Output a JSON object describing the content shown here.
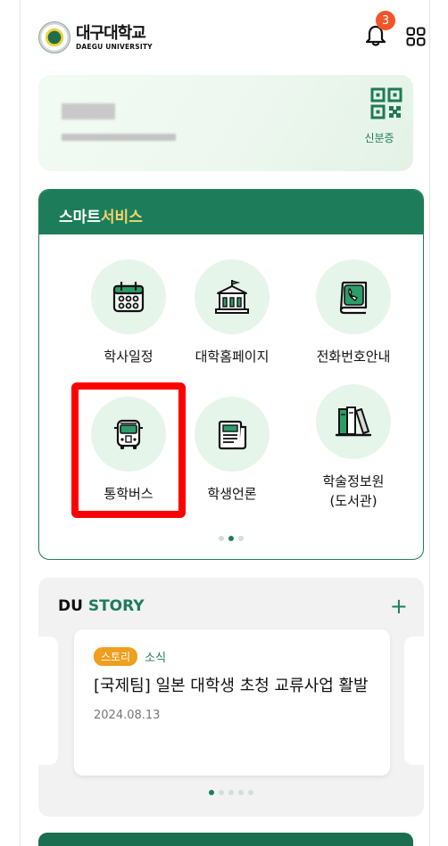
{
  "header": {
    "logo_kr": "대구대학교",
    "logo_en": "DAEGU UNIVERSITY",
    "notification_count": "3",
    "icons": [
      "bell-icon",
      "apps-grid-icon"
    ]
  },
  "id_card": {
    "qr_label": "신분증"
  },
  "smart_service": {
    "title_a": "스마트",
    "title_b": "서비스",
    "items": [
      {
        "label": "학사일정",
        "icon": "calendar-icon"
      },
      {
        "label": "대학홈페이지",
        "icon": "university-building-icon"
      },
      {
        "label": "전화번호안내",
        "icon": "phone-directory-icon"
      },
      {
        "label": "통학버스",
        "icon": "bus-icon"
      },
      {
        "label": "학생언론",
        "icon": "newspaper-icon"
      },
      {
        "label_line1": "학술정보원",
        "label_line2": "(도서관)",
        "icon": "library-books-icon"
      }
    ],
    "page_dots": 3,
    "active_dot": 1
  },
  "du_story": {
    "title_a": "DU",
    "title_b": "STORY",
    "plus": "+",
    "card": {
      "tag": "스토리",
      "category": "소식",
      "headline": "[국제팀] 일본 대학생 초청 교류사업 활발",
      "date": "2024.08.13"
    },
    "page_dots": 5,
    "active_dot": 0
  },
  "colors": {
    "brand_green": "#1d7d5a",
    "accent_yellow": "#f3d56a",
    "badge_orange": "#f0552a",
    "tag_orange": "#ef9e1d",
    "highlight_red": "#ff0000"
  }
}
